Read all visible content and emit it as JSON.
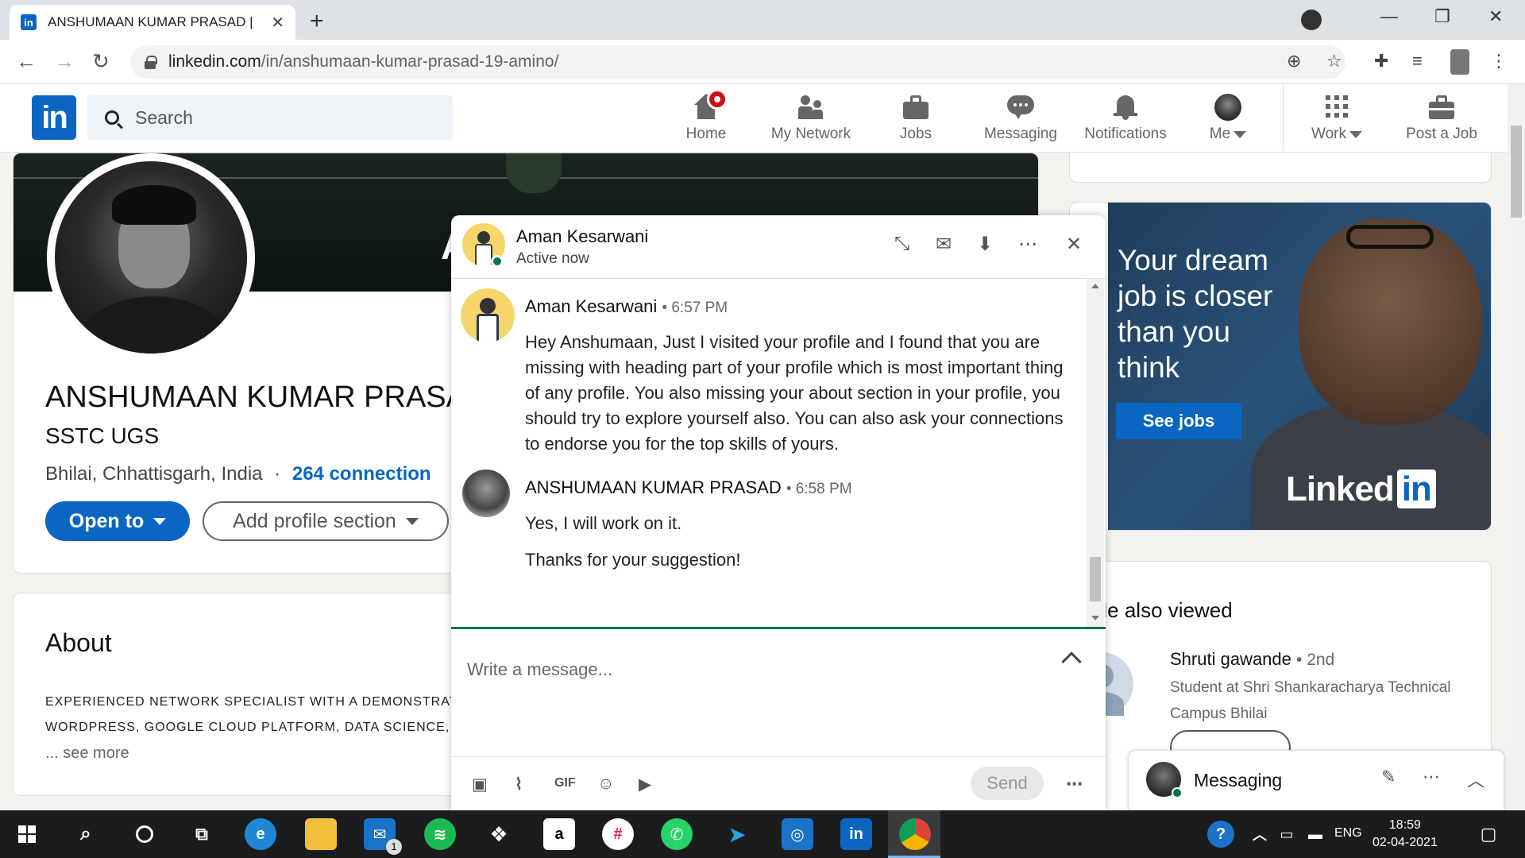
{
  "browser": {
    "tab_title": "ANSHUMAAN KUMAR PRASAD |",
    "url_domain": "linkedin.com",
    "url_path": "/in/anshumaan-kumar-prasad-19-amino/"
  },
  "linkedin": {
    "logo_text": "in",
    "search_placeholder": "Search",
    "nav": {
      "home": "Home",
      "network": "My Network",
      "jobs": "Jobs",
      "messaging": "Messaging",
      "notifications": "Notifications",
      "me": "Me",
      "work": "Work",
      "post_job": "Post a Job"
    }
  },
  "profile": {
    "banner_letter": "A",
    "name": "ANSHUMAAN KUMAR PRASA",
    "headline": "SSTC UGS",
    "location": "Bhilai, Chhattisgarh, India",
    "separator": "·",
    "connections": "264 connection",
    "open_to": "Open to",
    "add_section": "Add profile section"
  },
  "about": {
    "title": "About",
    "line1": "EXPERIENCED NETWORK SPECIALIST WITH A DEMONSTRATEI",
    "line2": "WORDPRESS, GOOGLE CLOUD PLATFORM, DATA SCIENCE, C+",
    "see_more": "... see more"
  },
  "ad": {
    "headline": "Your dream job is closer than you think",
    "button": "See jobs",
    "brand": "Linked",
    "brand_box": "in"
  },
  "people_also_viewed": {
    "title": "eople also viewed",
    "person_name": "Shruti gawande",
    "person_degree": "• 2nd",
    "person_subtitle": "Student at Shri Shankaracharya Technical Campus Bhilai"
  },
  "messaging_bar": {
    "title": "Messaging"
  },
  "chat": {
    "contact_name": "Aman Kesarwani",
    "status": "Active now",
    "messages": [
      {
        "sender": "Aman Kesarwani",
        "time": "• 6:57 PM",
        "text": "Hey Anshumaan, Just I visited your profile and I found that you are missing with heading part of your profile which is most important thing of any profile. You also missing your about section in your profile, you should try to explore yourself also. You can also ask your connections to endorse you for the top skills of yours."
      },
      {
        "sender": "ANSHUMAAN KUMAR PRASAD",
        "time": "• 6:58 PM",
        "text": "Yes, I will work on it.",
        "text2": "Thanks for your suggestion!"
      }
    ],
    "compose_placeholder": "Write a message...",
    "gif_label": "GIF",
    "send_label": "Send"
  },
  "taskbar": {
    "time": "18:59",
    "date": "02-04-2021",
    "lang": "ENG",
    "mail_badge": "1"
  },
  "colors": {
    "linkedin_blue": "#0a66c2",
    "online_green": "#057642",
    "notification_red": "#cc1016"
  }
}
